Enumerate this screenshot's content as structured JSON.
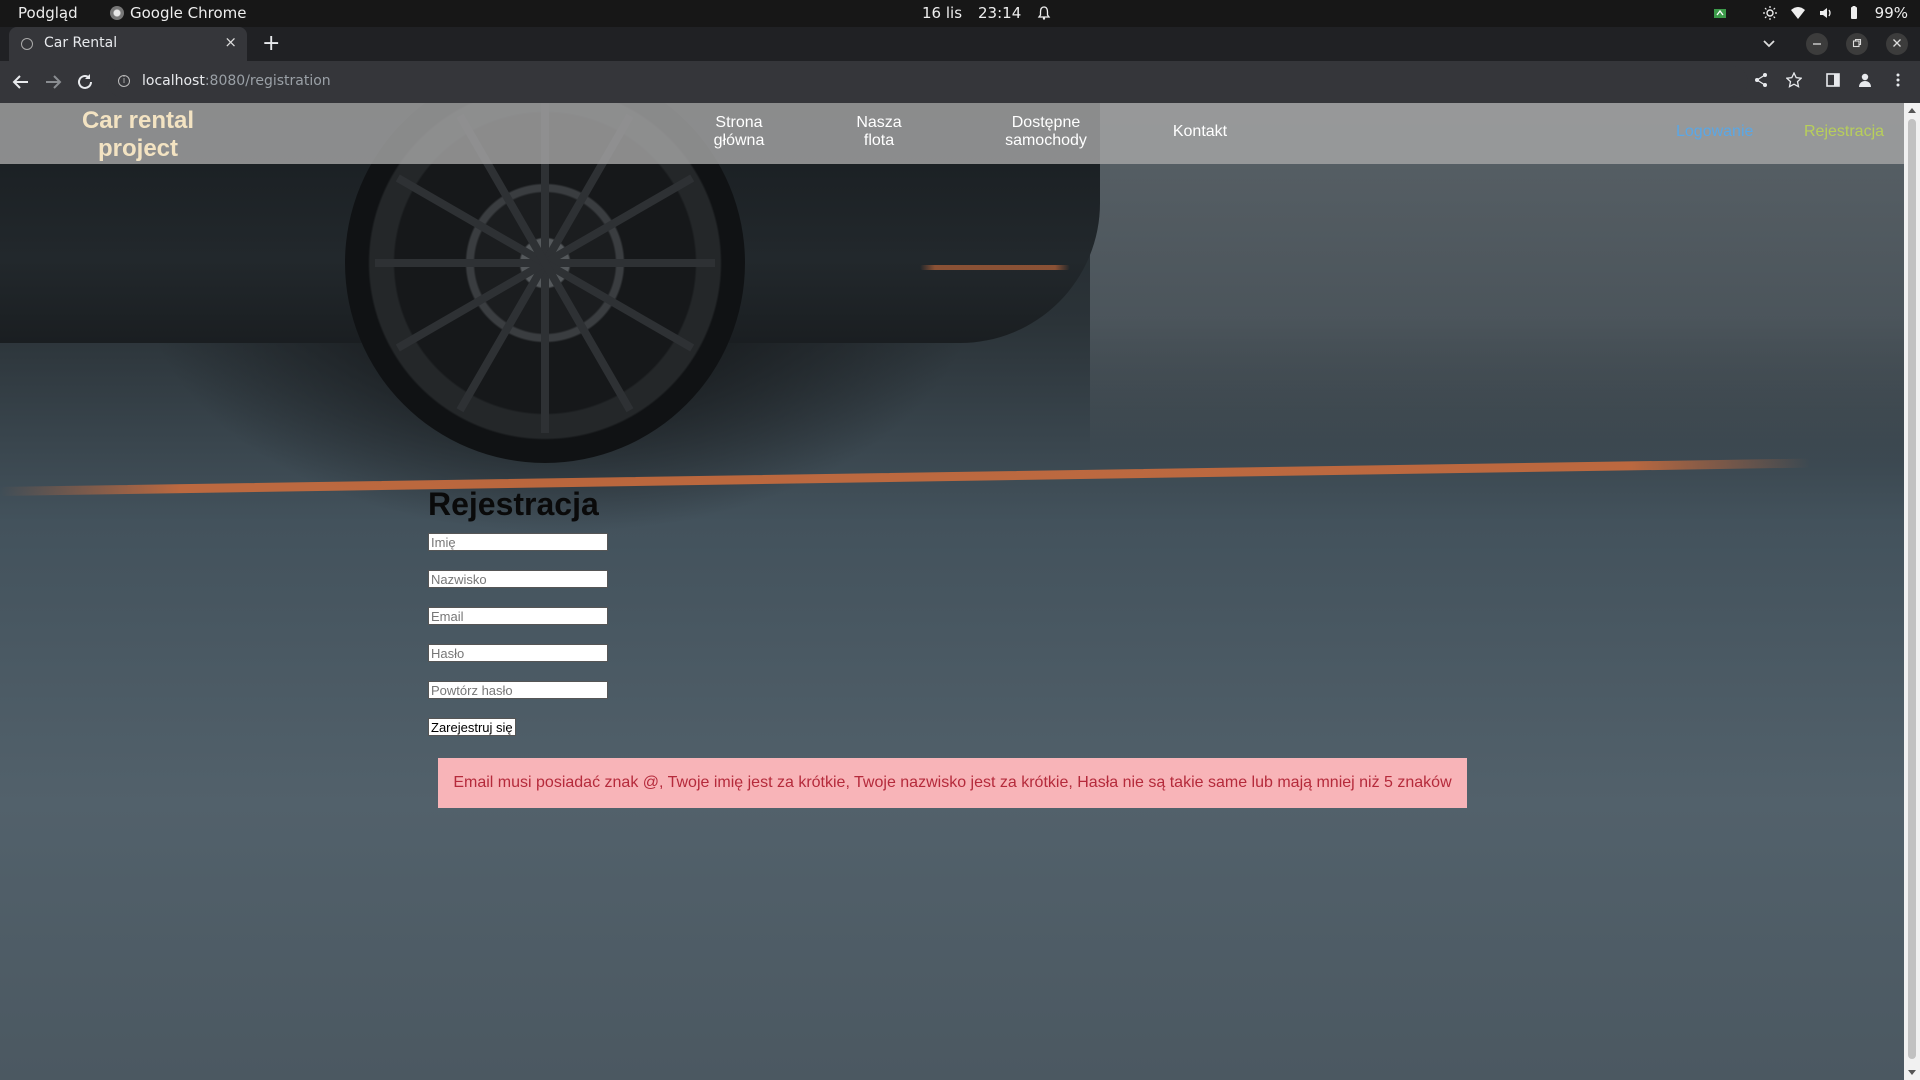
{
  "os_panel": {
    "activities": "Podgląd",
    "app_name": "Google Chrome",
    "date": "16 lis",
    "time": "23:14",
    "battery": "99%"
  },
  "browser": {
    "tab_title": "Car Rental",
    "tab_close": "×",
    "new_tab": "+",
    "url_host": "localhost",
    "url_path": ":8080/registration"
  },
  "site": {
    "brand_line1": "Car rental",
    "brand_line2": "project",
    "nav": {
      "home_line1": "Strona",
      "home_line2": "główna",
      "fleet_line1": "Nasza",
      "fleet_line2": "flota",
      "available_line1": "Dostępne",
      "available_line2": "samochody",
      "contact": "Kontakt"
    },
    "login": "Logowanie",
    "register": "Rejestracja"
  },
  "form": {
    "title": "Rejestracja",
    "first_name_placeholder": "Imię",
    "last_name_placeholder": "Nazwisko",
    "email_placeholder": "Email",
    "password_placeholder": "Hasło",
    "repeat_password_placeholder": "Powtórz hasło",
    "submit_label": "Zarejestruj się",
    "error_message": "Email musi posiadać znak @, Twoje imię jest za krótkie, Twoje nazwisko jest za krótkie, Hasła nie są takie same lub mają mniej niż 5 znaków"
  },
  "colors": {
    "brand": "#f3e3c2",
    "login_link": "#5aa7e6",
    "register_link": "#b8cf5a",
    "error_bg": "#f8b4b8",
    "error_text": "#b52a3b"
  }
}
